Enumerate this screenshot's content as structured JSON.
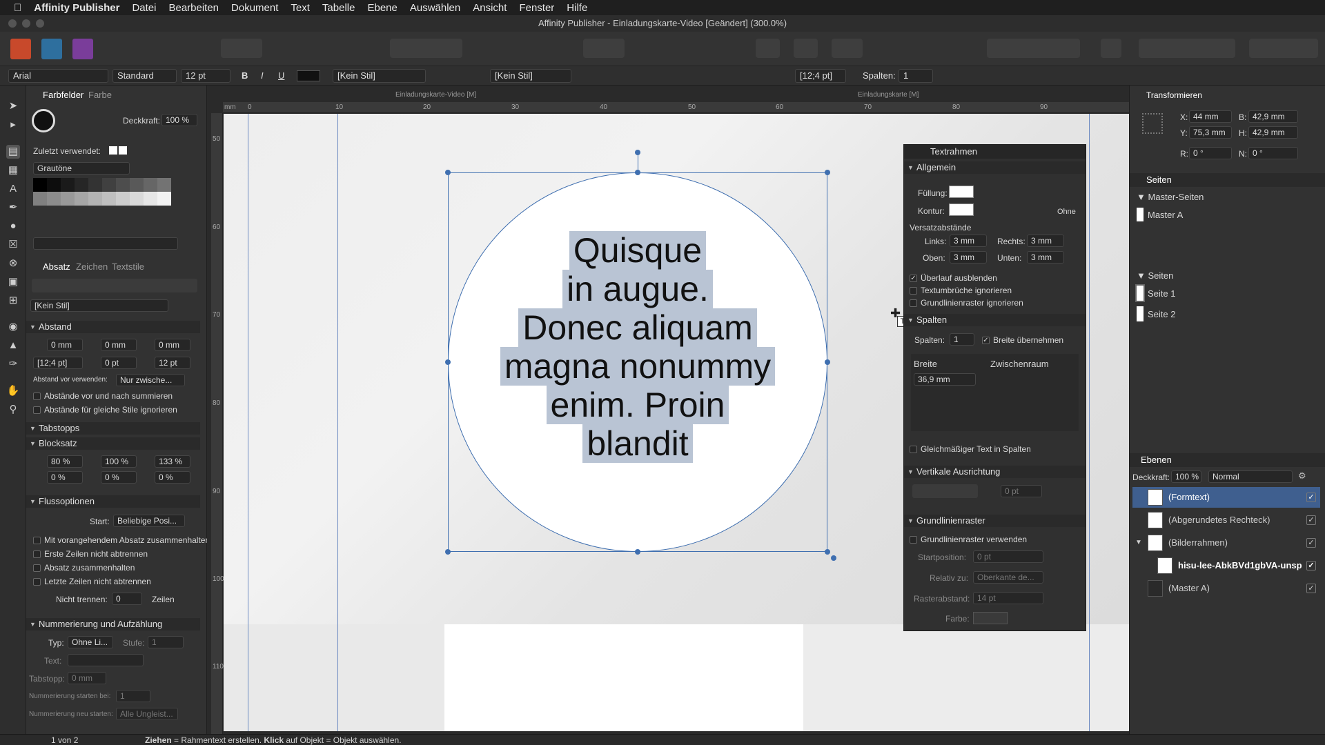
{
  "menubar": {
    "app": "Affinity Publisher",
    "items": [
      "Datei",
      "Bearbeiten",
      "Dokument",
      "Text",
      "Tabelle",
      "Ebene",
      "Auswählen",
      "Ansicht",
      "Fenster",
      "Hilfe"
    ]
  },
  "window": {
    "title": "Affinity Publisher - Einladungskarte-Video [Geändert] (300.0%)"
  },
  "context_toolbar": {
    "font": "Arial",
    "style": "Standard",
    "size": "12 pt",
    "bold": "B",
    "italic": "I",
    "underline": "U",
    "para_style": "[Kein Stil]",
    "char_style": "[Kein Stil]",
    "leading": "[12;4 pt]",
    "columns_label": "Spalten:",
    "columns_value": "1"
  },
  "doc_tabs": [
    "Einladungskarte-Video [M]",
    "Einladungskarte [M]"
  ],
  "ruler": {
    "unit": "mm",
    "h_ticks": [
      "0",
      "10",
      "20",
      "30",
      "40",
      "50",
      "60",
      "70",
      "80",
      "90"
    ],
    "v_ticks": [
      "50",
      "60",
      "70",
      "80",
      "90",
      "100",
      "110"
    ]
  },
  "left_panel": {
    "tabs": [
      "Farbfelder",
      "Farbe"
    ],
    "opacity_label": "Deckkraft:",
    "opacity_value": "100 %",
    "recent_label": "Zuletzt verwendet:",
    "palette": "Grautöne",
    "para_tabs": [
      "Absatz",
      "Zeichen",
      "Textstile"
    ],
    "para_style": "[Kein Stil]",
    "sections": {
      "abstand": "Abstand",
      "tabstopps": "Tabstopps",
      "blocksatz": "Blocksatz",
      "fluss": "Flussoptionen",
      "nummerierung": "Nummerierung und Aufzählung"
    },
    "abstand": {
      "left": "0 mm",
      "first": "0 mm",
      "right": "0 mm",
      "leading": "[12;4 pt]",
      "before": "0 pt",
      "after": "12 pt",
      "vor_label": "Abstand vor verwenden:",
      "vor_value": "Nur zwische...",
      "cb1": "Abstände vor und nach summieren",
      "cb2": "Abstände für gleiche Stile ignorieren"
    },
    "blocksatz": {
      "v1": "80 %",
      "v2": "100 %",
      "v3": "133 %",
      "v4": "0 %",
      "v5": "0 %",
      "v6": "0 %"
    },
    "fluss": {
      "start_label": "Start:",
      "start_value": "Beliebige Posi...",
      "cb1": "Mit vorangehendem Absatz zusammenhalten",
      "cb2": "Erste Zeilen nicht abtrennen",
      "cb3": "Absatz zusammenhalten",
      "cb4": "Letzte Zeilen nicht abtrennen",
      "nicht_label": "Nicht trennen:",
      "nicht_value": "0",
      "zeilen": "Zeilen"
    },
    "num": {
      "typ_label": "Typ:",
      "typ_value": "Ohne Li...",
      "stufe_label": "Stufe:",
      "stufe_value": "1",
      "text_label": "Text:",
      "tab_label": "Tabstopp:",
      "tab_value": "0 mm",
      "start_label": "Nummerierung starten bei:",
      "start_value": "1",
      "neu_label": "Nummerierung neu starten:",
      "neu_value": "Alle Ungleist..."
    }
  },
  "canvas": {
    "lines": [
      "Quisque",
      "in augue.",
      "Donec aliquam",
      "magna nonummy",
      "enim. Proin",
      "blandit"
    ]
  },
  "textframe_panel": {
    "title": "Textrahmen",
    "allgemein": "Allgemein",
    "fill_label": "Füllung:",
    "stroke_label": "Kontur:",
    "stroke_value": "Ohne",
    "versatz": "Versatzabstände",
    "links_label": "Links:",
    "links": "3 mm",
    "rechts_label": "Rechts:",
    "rechts": "3 mm",
    "oben_label": "Oben:",
    "oben": "3 mm",
    "unten_label": "Unten:",
    "unten": "3 mm",
    "cb_overflow": "Überlauf ausblenden",
    "cb_textwrap": "Textumbrüche ignorieren",
    "cb_baseline": "Grundlinienraster ignorieren",
    "spalten": "Spalten",
    "spalten_label": "Spalten:",
    "spalten_value": "1",
    "breite_uebernehmen": "Breite übernehmen",
    "breite": "Breite",
    "zwischenraum": "Zwischenraum",
    "breite_value": "36,9 mm",
    "cb_gleich": "Gleichmäßiger Text in Spalten",
    "vert": "Vertikale Ausrichtung",
    "vert_value": "0 pt",
    "grund": "Grundlinienraster",
    "cb_grund": "Grundlinienraster verwenden",
    "startpos_label": "Startposition:",
    "startpos": "0 pt",
    "relativ_label": "Relativ zu:",
    "relativ": "Oberkante de...",
    "raster_label": "Rasterabstand:",
    "raster": "14 pt",
    "farbe_label": "Farbe:"
  },
  "right_panel": {
    "transform": {
      "title": "Transformieren",
      "x": "44 mm",
      "y": "75,3 mm",
      "w": "42,9 mm",
      "h": "42,9 mm",
      "r": "0 °",
      "n": "0 °",
      "x_label": "X:",
      "y_label": "Y:",
      "w_label": "B:",
      "h_label": "H:",
      "r_label": "R:",
      "n_label": "N:"
    },
    "seiten_title": "Seiten",
    "master_title": "Master-Seiten",
    "master": "Master A",
    "pages_title": "Seiten",
    "pages": [
      "Seite 1",
      "Seite 2"
    ],
    "layers_title": "Ebenen",
    "layers_opacity_label": "Deckkraft:",
    "layers_opacity": "100 %",
    "blend": "Normal",
    "layers": [
      "(Formtext)",
      "(Abgerundetes Rechteck)",
      "(Bilderrahmen)",
      "hisu-lee-AbkBVd1gbVA-unsp",
      "(Master A)"
    ]
  },
  "status": {
    "page": "1 von 2",
    "hint_bold1": "Ziehen",
    "hint1": " = Rahmentext erstellen. ",
    "hint_bold2": "Klick",
    "hint2": " auf Objekt = Objekt auswählen."
  }
}
